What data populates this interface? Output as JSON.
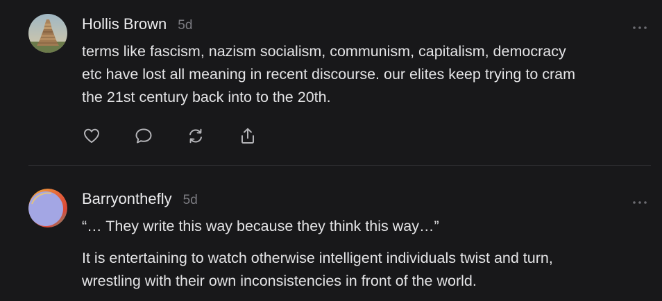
{
  "posts": [
    {
      "author": "Hollis Brown",
      "time": "5d",
      "avatar_icon": "tower-of-babel-painting-avatar",
      "text_lines": [
        "terms like fascism, nazism socialism, communism, capitalism, democracy",
        "etc have lost all meaning in recent discourse. our elites keep trying to cram",
        "the 21st century back into to the 20th."
      ],
      "actions": [
        "heart-icon",
        "comment-icon",
        "restack-icon",
        "share-icon"
      ]
    },
    {
      "author": "Barryonthefly",
      "time": "5d",
      "avatar_icon": "gradient-circle-avatar",
      "quote": "“… They write this way because they think this way…”",
      "text_lines": [
        "It is entertaining to watch otherwise intelligent individuals twist and turn,",
        "wrestling with their own inconsistencies in front of the world."
      ]
    }
  ],
  "colors": {
    "background": "#18181a",
    "text": "#e4e4e6",
    "muted": "#7c7c82",
    "divider": "#2c2c2f"
  }
}
